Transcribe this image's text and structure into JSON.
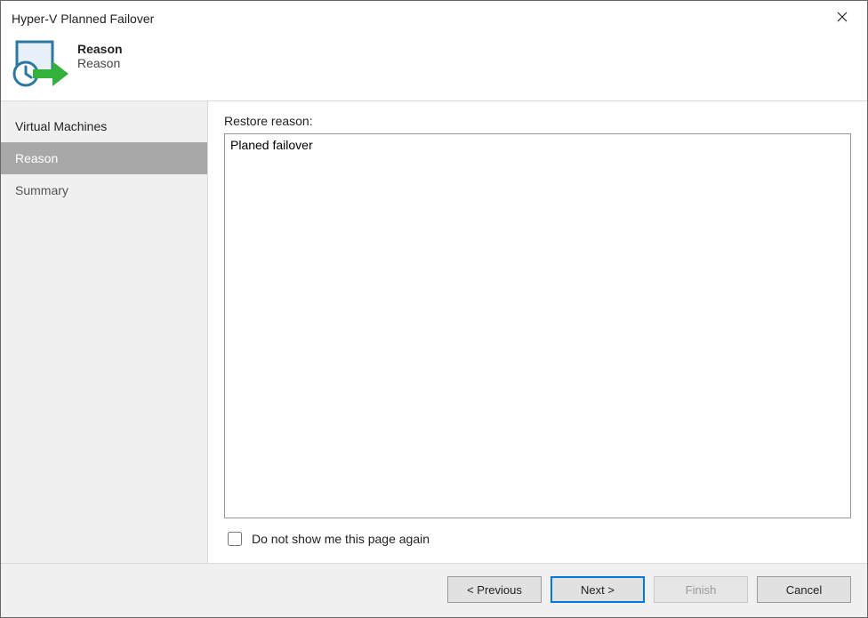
{
  "window": {
    "title": "Hyper-V Planned Failover"
  },
  "header": {
    "title": "Reason",
    "subtitle": "Reason"
  },
  "sidebar": {
    "items": [
      {
        "label": "Virtual Machines",
        "state": "done"
      },
      {
        "label": "Reason",
        "state": "active"
      },
      {
        "label": "Summary",
        "state": "future"
      }
    ]
  },
  "main": {
    "reason_label": "Restore reason:",
    "reason_value": "Planed failover",
    "dont_show_label": "Do not show me this page again"
  },
  "footer": {
    "previous": "< Previous",
    "next": "Next >",
    "finish": "Finish",
    "cancel": "Cancel"
  }
}
